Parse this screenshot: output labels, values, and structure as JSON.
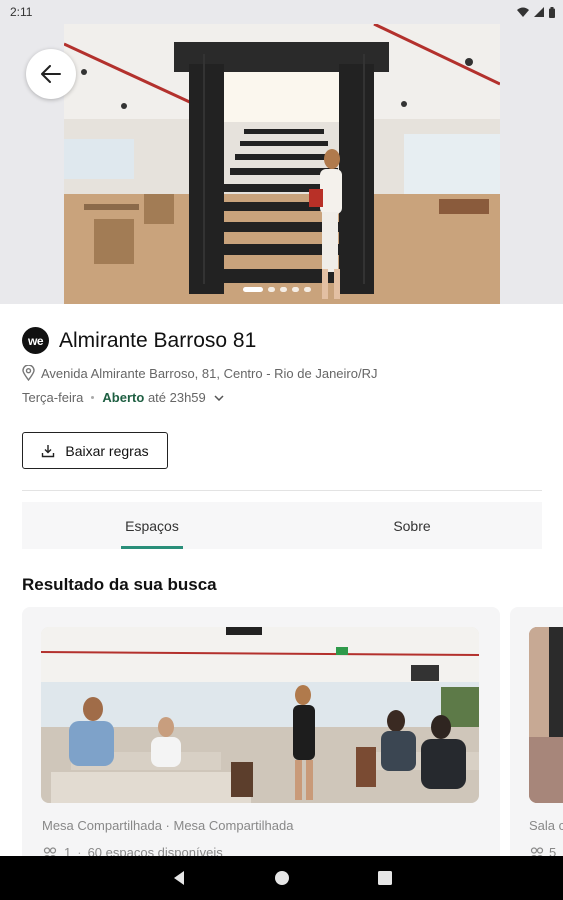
{
  "status_bar": {
    "time": "2:11"
  },
  "hero": {
    "slide_count": 5,
    "active_slide": 0
  },
  "location": {
    "brand_logo_text": "we",
    "title": "Almirante Barroso 81",
    "address": "Avenida Almirante Barroso, 81, Centro - Rio de Janeiro/RJ",
    "day": "Terça-feira",
    "open_status": "Aberto",
    "open_until": "até 23h59"
  },
  "actions": {
    "download_label": "Baixar regras"
  },
  "tabs": [
    {
      "label": "Espaços",
      "active": true
    },
    {
      "label": "Sobre",
      "active": false
    }
  ],
  "results": {
    "heading": "Resultado da sua busca",
    "cards": [
      {
        "subtitle": "Mesa Compartilhada · Mesa Compartilhada",
        "capacity": "1",
        "availability": "60 espaços disponíveis"
      },
      {
        "subtitle": "Sala c",
        "capacity": "5"
      }
    ]
  },
  "colors": {
    "accent": "#2a8f7a",
    "open_green": "#1e5f42",
    "hero_bg": "#e9e9ec"
  },
  "icons": [
    "wifi-icon",
    "signal-icon",
    "battery-icon",
    "back-arrow-icon",
    "location-pin-icon",
    "chevron-down-icon",
    "download-icon",
    "people-icon",
    "nav-back-icon",
    "nav-home-icon",
    "nav-recents-icon"
  ]
}
